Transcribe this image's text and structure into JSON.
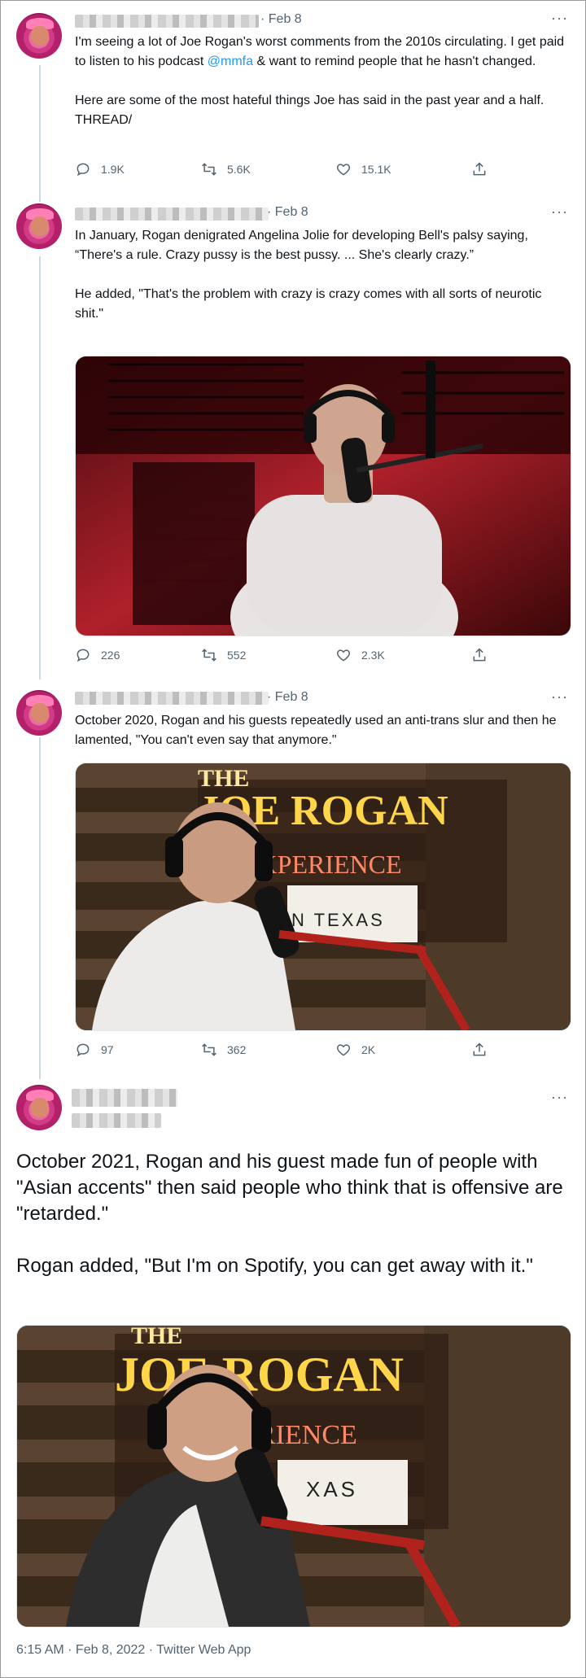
{
  "tweets": [
    {
      "date": "· Feb 8",
      "text_before": "I'm seeing a lot of Joe Rogan's worst comments from the 2010s circulating. I get paid to listen to his podcast ",
      "mention": "@mmfa",
      "text_after": " & want to remind people that he hasn't changed.\n\nHere are some of the most hateful things Joe has said in the past year and a half. THREAD/",
      "replies": "1.9K",
      "retweets": "5.6K",
      "likes": "15.1K"
    },
    {
      "date": "· Feb 8",
      "text": "In January, Rogan denigrated Angelina Jolie for developing Bell's palsy saying, “There's a rule. Crazy pussy is the best pussy. ... She's clearly crazy.”\n\nHe added, \"That's the problem with crazy is crazy comes with all sorts of neurotic shit.\"",
      "replies": "226",
      "retweets": "552",
      "likes": "2.3K"
    },
    {
      "date": "· Feb 8",
      "text": "October 2020, Rogan and his guests repeatedly used an anti-trans slur and then he lamented, \"You can't even say that anymore.\"",
      "replies": "97",
      "retweets": "362",
      "likes": "2K",
      "sign_line1": "THE",
      "sign_line2": "JOE ROGAN",
      "sign_line3": "EXPERIENCE",
      "sign_line4": "N TEXAS"
    },
    {
      "text": "October 2021, Rogan and his guest made fun of people with \"Asian accents\" then said people who think that is offensive are \"retarded.\"\n\nRogan added, \"But I'm on Spotify, you can get away with it.\"",
      "sign_line1": "THE",
      "sign_line2": "JOE ROGAN",
      "sign_line3": "EXPERIENCE",
      "sign_line4": "XAS",
      "footer": "6:15 AM · Feb 8, 2022 · Twitter Web App"
    }
  ],
  "icons": {
    "more": "···"
  },
  "colors": {
    "mention": "#1d9bf0",
    "meta": "#536471",
    "text": "#0f1419"
  }
}
